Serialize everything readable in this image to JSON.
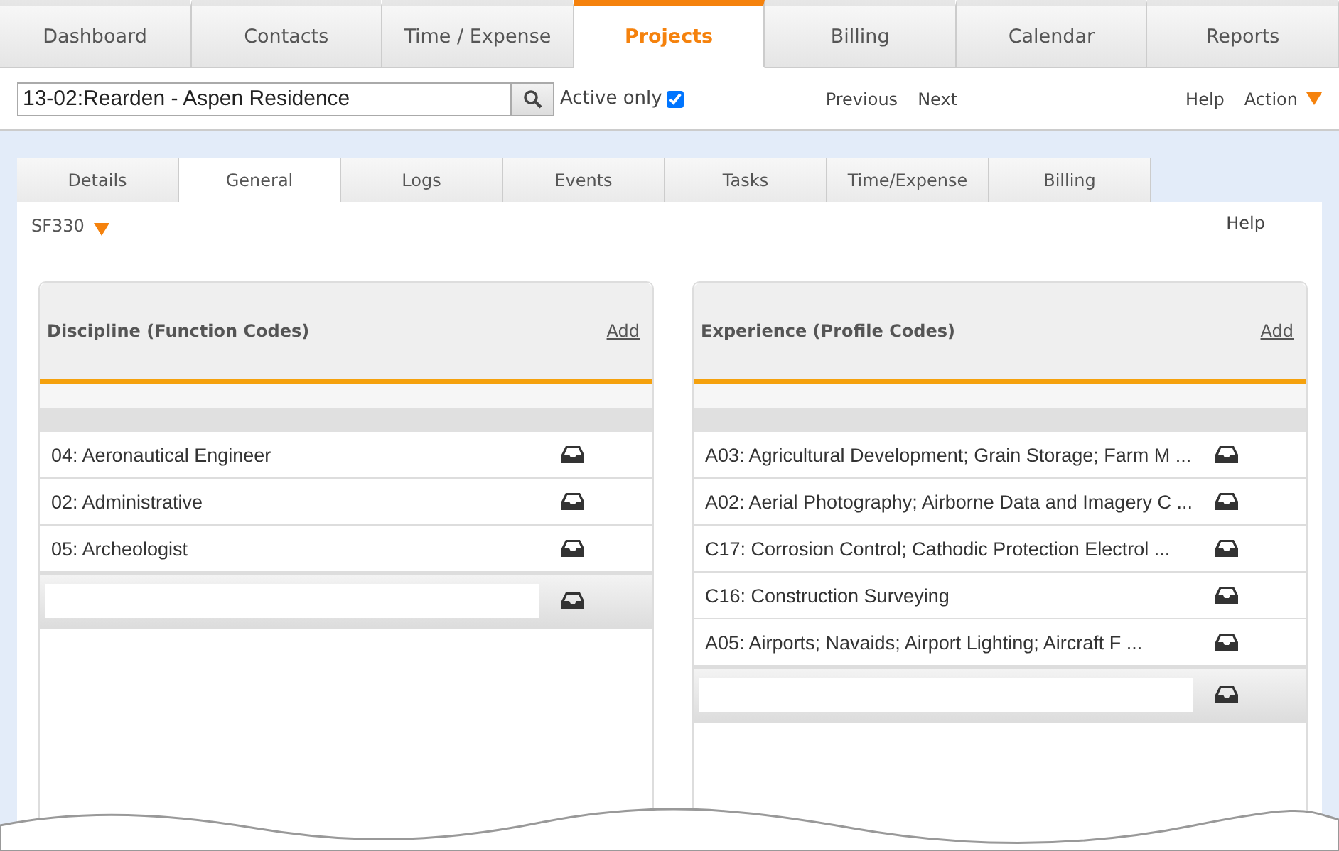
{
  "main_tabs": [
    {
      "label": "Dashboard",
      "selected": false
    },
    {
      "label": "Contacts",
      "selected": false
    },
    {
      "label": "Time / Expense",
      "selected": false
    },
    {
      "label": "Projects",
      "selected": true
    },
    {
      "label": "Billing",
      "selected": false
    },
    {
      "label": "Calendar",
      "selected": false
    },
    {
      "label": "Reports",
      "selected": false
    }
  ],
  "toolbar": {
    "project": "13-02:Rearden - Aspen Residence",
    "active_only_label": "Active only",
    "active_only_checked": true,
    "previous": "Previous",
    "next": "Next",
    "help": "Help",
    "action": "Action"
  },
  "sub_tabs": [
    {
      "label": "Details",
      "selected": false
    },
    {
      "label": "General",
      "selected": true
    },
    {
      "label": "Logs",
      "selected": false
    },
    {
      "label": "Events",
      "selected": false
    },
    {
      "label": "Tasks",
      "selected": false
    },
    {
      "label": "Time/Expense",
      "selected": false
    },
    {
      "label": "Billing",
      "selected": false
    }
  ],
  "form_selector": "SF330",
  "help": "Help",
  "panels": [
    {
      "title": "Discipline (Function Codes)",
      "add": "Add",
      "items": [
        "04: Aeronautical Engineer",
        "02: Administrative",
        "05: Archeologist"
      ]
    },
    {
      "title": "Experience (Profile Codes)",
      "add": "Add",
      "items": [
        "A03: Agricultural Development; Grain Storage; Farm M ...",
        "A02: Aerial Photography; Airborne Data and Imagery C ...",
        "C17: Corrosion Control; Cathodic Protection Electrol ...",
        "C16: Construction Surveying",
        "A05: Airports; Navaids; Airport Lighting; Aircraft F ..."
      ]
    }
  ]
}
